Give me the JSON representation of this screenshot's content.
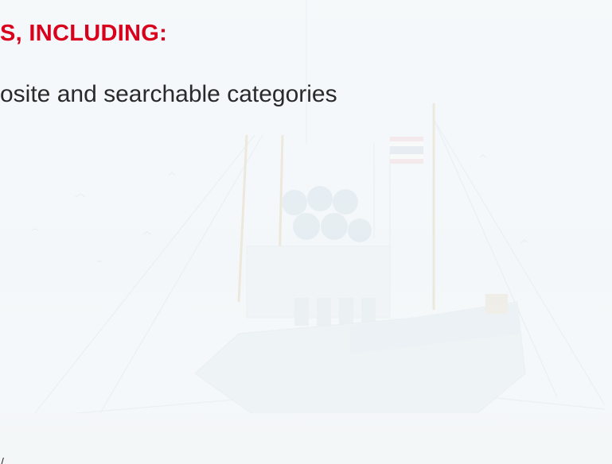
{
  "content": {
    "heading": "S, INCLUDING:",
    "line_1": "osite and searchable categories",
    "bottom_fragment": "/"
  },
  "colors": {
    "heading": "#d9001b",
    "text": "#2a2a2a",
    "background": "#f5f8fa",
    "boat_faded": "#dfe8ee"
  },
  "icons": {
    "background": "fishing-boat-photo"
  }
}
